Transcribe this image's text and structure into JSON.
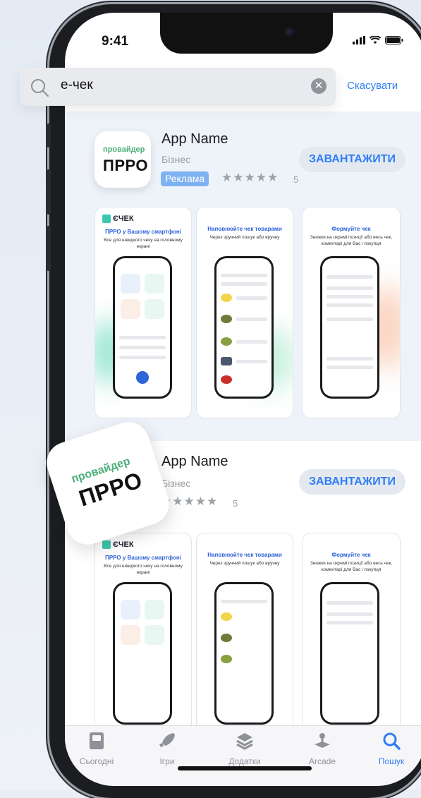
{
  "status_bar": {
    "time": "9:41"
  },
  "search": {
    "query": "е-чек",
    "cancel_label": "Скасувати"
  },
  "results": [
    {
      "icon_top": "провайдер",
      "icon_bottom": "ПРРО",
      "name": "App Name",
      "category": "Бізнес",
      "ad_label": "Реклама",
      "stars": "★★★★★",
      "rating_count": "5",
      "get_label": "ЗАВАНТАЖИТИ"
    },
    {
      "icon_top": "провайдер",
      "icon_bottom": "ПРРО",
      "name": "App Name",
      "category": "Бізнес",
      "stars": "★★★★★",
      "rating_count": "5",
      "get_label": "ЗАВАНТАЖИТИ"
    }
  ],
  "screenshots": {
    "logo": "ЄЧЕК",
    "shot1_title": "ПРРО у Вашому смартфоні",
    "shot1_sub": "Все для швидкого чеку на головному екрані",
    "shot2_title": "Наповнюйте чек товарами",
    "shot2_sub": "Через зручний пошук або вручну",
    "shot3_title": "Формуйте чек",
    "shot3_sub": "Знижки на окремі позиції або весь чек, коментарі для Вас і покупця"
  },
  "tabbar": {
    "today": "Сьогодні",
    "games": "Ігри",
    "apps": "Додатки",
    "arcade": "Arcade",
    "search": "Пошук"
  }
}
